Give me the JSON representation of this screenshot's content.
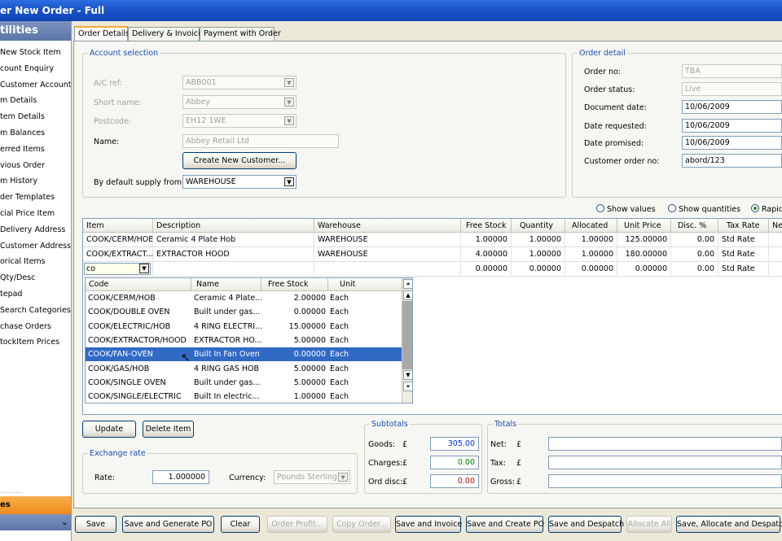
{
  "window": {
    "title": "er New Order - Full"
  },
  "sidebar": {
    "header": "tilities",
    "items": [
      "New Stock Item",
      "count Enquiry",
      "Customer Account",
      "m Details",
      "tem Details",
      "m Balances",
      "erred Items",
      "vious Order",
      "m History",
      "der Templates",
      "cial Price Item",
      "Delivery Address",
      "Customer Address",
      "orical Items",
      "Qty/Desc",
      "tepad",
      "Search Categories",
      "chase Orders",
      "tockItem Prices"
    ],
    "dots": "·········",
    "orange_label": "es"
  },
  "tabs": [
    "Order Details",
    "Delivery & Invoicing",
    "Payment with Order"
  ],
  "account": {
    "legend": "Account selection",
    "ac_ref_label": "A/C ref:",
    "ac_ref": "ABB001",
    "short_name_label": "Short name:",
    "short_name": "Abbey",
    "postcode_label": "Postcode:",
    "postcode": "EH12 1WE",
    "name_label": "Name:",
    "name": "Abbey Retail Ltd",
    "create_button": "Create New Customer...",
    "supply_label": "By default supply from:",
    "supply": "WAREHOUSE"
  },
  "order_detail": {
    "legend": "Order detail",
    "order_no_label": "Order no:",
    "order_no": "TBA",
    "status_label": "Order status:",
    "status": "Live",
    "doc_date_label": "Document date:",
    "doc_date": "10/06/2009",
    "requested_label": "Date requested:",
    "requested": "10/06/2009",
    "promised_label": "Date promised:",
    "promised": "10/06/2009",
    "cust_order_label": "Customer order no:",
    "cust_order": "abord/123"
  },
  "view_options": [
    "Show values",
    "Show quantities",
    "Rapid"
  ],
  "grid": {
    "headers": [
      "Item",
      "Description",
      "Warehouse",
      "Free Stock",
      "Quantity",
      "Allocated",
      "Unit Price",
      "Disc. %",
      "Tax Rate",
      "Ne"
    ],
    "rows": [
      [
        "COOK/CERM/HOB",
        "Ceramic 4 Plate Hob",
        "WAREHOUSE",
        "1.00000",
        "1.00000",
        "1.00000",
        "125.00000",
        "0.00",
        "Std Rate"
      ],
      [
        "COOK/EXTRACT...",
        "EXTRACTOR HOOD",
        "WAREHOUSE",
        "4.00000",
        "1.00000",
        "1.00000",
        "180.00000",
        "0.00",
        "Std Rate"
      ],
      [
        "co",
        "",
        "",
        "0.00000",
        "0.00000",
        "0.00000",
        "0.00000",
        "0.00",
        "Std Rate"
      ]
    ]
  },
  "lookup": {
    "headers": [
      "Code",
      "Name",
      "Free Stock",
      "Unit"
    ],
    "rows": [
      [
        "COOK/CERM/HOB",
        "Ceramic 4 Plate...",
        "2.00000",
        "Each"
      ],
      [
        "COOK/DOUBLE OVEN",
        "Built under gas...",
        "0.00000",
        "Each"
      ],
      [
        "COOK/ELECTRIC/HOB",
        "4 RING ELECTRI...",
        "15.00000",
        "Each"
      ],
      [
        "COOK/EXTRACTOR/HOOD",
        "EXTRACTOR HO...",
        "5.00000",
        "Each"
      ],
      [
        "COOK/FAN-OVEN",
        "Built In Fan Oven",
        "0.00000",
        "Each"
      ],
      [
        "COOK/GAS/HOB",
        "4 RING GAS HOB",
        "5.00000",
        "Each"
      ],
      [
        "COOK/SINGLE OVEN",
        "Built under gas...",
        "5.00000",
        "Each"
      ],
      [
        "COOK/SINGLE/ELECTRIC",
        "Built  In electric...",
        "1.00000",
        "Each"
      ]
    ],
    "selected_index": 4
  },
  "actions": {
    "update": "Update",
    "delete": "Delete Item"
  },
  "exchange": {
    "legend": "Exchange rate",
    "rate_label": "Rate:",
    "rate": "1.000000",
    "currency_label": "Currency:",
    "currency": "Pounds Sterling"
  },
  "subtotals": {
    "legend": "Subtotals",
    "goods_label": "Goods:",
    "goods": "305.00",
    "charges_label": "Charges:",
    "charges": "0.00",
    "orddisc_label": "Ord disc:",
    "orddisc": "0.00",
    "currency_symbol": "£"
  },
  "totals": {
    "legend": "Totals",
    "net_label": "Net:",
    "tax_label": "Tax:",
    "gross_label": "Gross:",
    "currency_symbol": "£"
  },
  "bottom_buttons": [
    "Save",
    "Save and Generate PO",
    "Clear",
    "Order Profit...",
    "Copy Order...",
    "Save and Invoice",
    "Save and Create PO",
    "Save and Despatch",
    "Allocate All",
    "Save, Allocate and Despatch"
  ],
  "colors": {
    "title": "#1a54c9",
    "selection": "#316ac5",
    "legend": "#1a4eb0",
    "goods_text": "#0033cc",
    "charges_text": "#008000",
    "orddisc_text": "#cc0000",
    "accent_tab": "#f0a83a",
    "sidebar_orange": "#f39a2e"
  }
}
